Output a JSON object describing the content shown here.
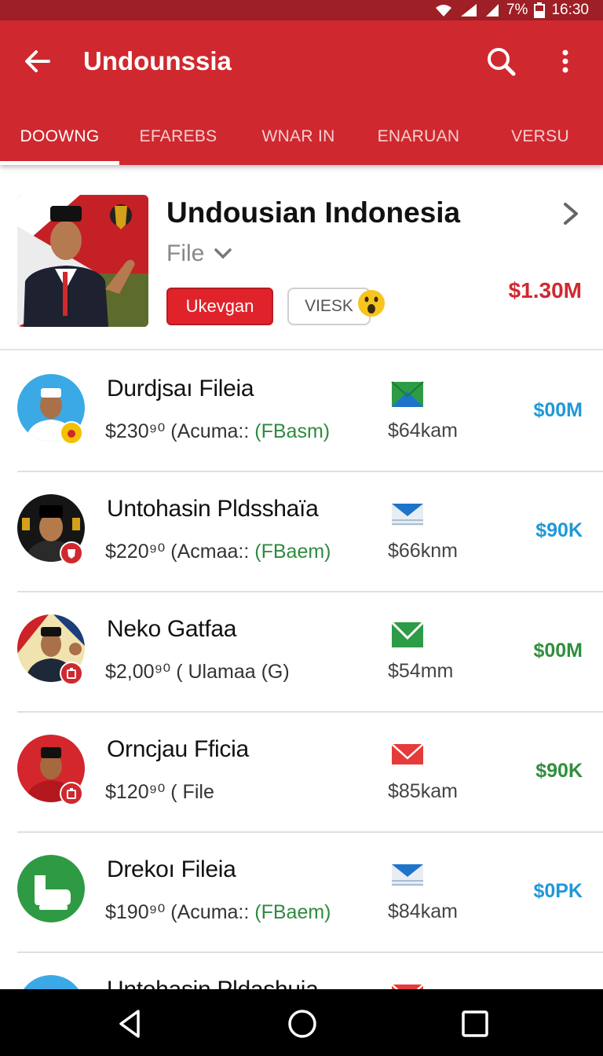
{
  "status": {
    "battery": "7%",
    "time": "16:30"
  },
  "appbar": {
    "title": "Undounssia"
  },
  "tabs": [
    {
      "label": "DOOWNG",
      "active": true
    },
    {
      "label": "EFAREBS",
      "active": false
    },
    {
      "label": "WNAR IN",
      "active": false
    },
    {
      "label": "ENARUAN",
      "active": false
    },
    {
      "label": "VERSU",
      "active": false
    }
  ],
  "hero": {
    "name": "Undousian Indonesia",
    "subtitle": "File",
    "primary_button": "Ukevgan",
    "secondary_button": "VIESK",
    "price": "$1.30M"
  },
  "rows": [
    {
      "name": "Durdjsaı Fileia",
      "sub_prefix": "$230⁹⁰ (Acuma:: ",
      "sub_green": "(FBasm)",
      "amount": "$64kam",
      "value": "$00M",
      "value_color": "blue",
      "mail": "green-blue",
      "badge": "#f2c200"
    },
    {
      "name": "Untohasin Pldsshaïa",
      "sub_prefix": "$220⁹⁰ (Acmaa:: ",
      "sub_green": "(FBaem)",
      "amount": "$66knm",
      "value": "$90K",
      "value_color": "blue",
      "mail": "blue",
      "badge": "#d0282f"
    },
    {
      "name": "Neko Gatfaa",
      "sub_prefix": "$2,00⁹⁰ ( Ulamaa (G)",
      "sub_green": "",
      "amount": "$54mm",
      "value": "$00M",
      "value_color": "green",
      "mail": "green",
      "badge": "#d0282f"
    },
    {
      "name": "Orncjau Fficia",
      "sub_prefix": "$120⁹⁰ ( File",
      "sub_green": "",
      "amount": "$85kam",
      "value": "$90K",
      "value_color": "green",
      "mail": "red",
      "badge": "#d0282f"
    },
    {
      "name": "Drekoı Fileia",
      "sub_prefix": "$190⁹⁰ (Acuma:: ",
      "sub_green": "(FBaem)",
      "amount": "$84kam",
      "value": "$0PK",
      "value_color": "blue",
      "mail": "blue",
      "badge": ""
    },
    {
      "name": "Untohasin Pldashuia",
      "sub_prefix": "",
      "sub_green": "",
      "amount": "",
      "value": "",
      "value_color": "blue",
      "mail": "red",
      "badge": ""
    }
  ]
}
